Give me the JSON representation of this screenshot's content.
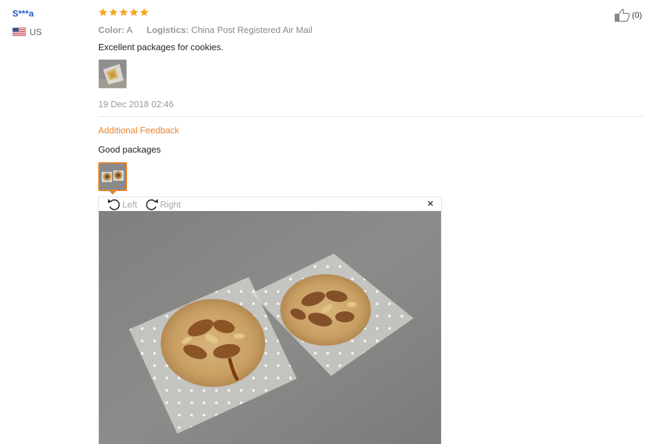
{
  "reviewer": {
    "name": "S***a",
    "country": "US",
    "flag_icon": "us-flag-icon"
  },
  "rating": {
    "stars": 5,
    "max": 5,
    "color": "#f5a623"
  },
  "helpful": {
    "count_text": "(0)",
    "icon": "thumbs-up-icon"
  },
  "attributes": {
    "color_label": "Color:",
    "color_value": "A",
    "logistics_label": "Logistics:",
    "logistics_value": "China Post Registered Air Mail"
  },
  "review": {
    "text": "Excellent packages for cookies.",
    "date": "19 Dec 2018 02:46"
  },
  "additional": {
    "title": "Additional Feedback",
    "text": "Good packages",
    "accent_color": "#e8842e"
  },
  "viewer": {
    "rotate_left_label": "Left",
    "rotate_right_label": "Right",
    "close_label": "×",
    "image_description_icon": "cookie-photo"
  }
}
